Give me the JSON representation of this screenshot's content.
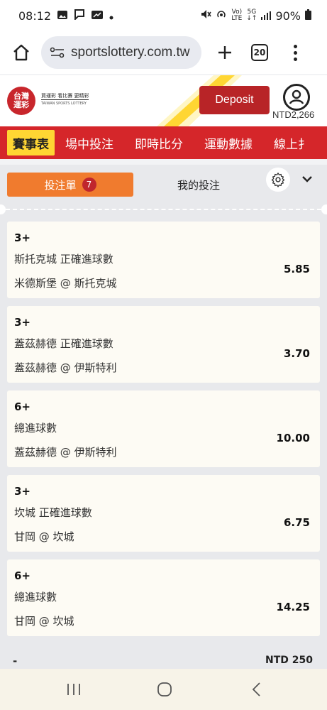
{
  "status_bar": {
    "time": "08:12",
    "battery": "90%",
    "lte_label": "LTE",
    "fiveg_label": "5G"
  },
  "browser": {
    "url": "sportslottery.com.tw",
    "tab_count": "20"
  },
  "header": {
    "logo_text": "台灣\n運彩",
    "logo_caption_top": "買運彩 看比賽 更精彩",
    "logo_caption_bottom": "TAIWAN SPORTS LOTTERY",
    "deposit_label": "Deposit",
    "balance": "NTD2,266"
  },
  "nav": {
    "items": [
      {
        "label": "賽事表",
        "active": true
      },
      {
        "label": "場中投注",
        "active": false
      },
      {
        "label": "即時比分",
        "active": false
      },
      {
        "label": "運動數據",
        "active": false
      },
      {
        "label": "線上扌",
        "active": false
      }
    ]
  },
  "slip": {
    "tab_active": "投注單",
    "badge_count": "7",
    "tab_other": "我的投注",
    "bets": [
      {
        "selection": "3+",
        "market": "斯托克城 正確進球數",
        "match": "米德斯堡 @ 斯托克城",
        "odds": "5.85"
      },
      {
        "selection": "3+",
        "market": "蓋茲赫德 正確進球數",
        "match": "蓋茲赫德 @ 伊斯特利",
        "odds": "3.70"
      },
      {
        "selection": "6+",
        "market": "總進球數",
        "match": "蓋茲赫德 @ 伊斯特利",
        "odds": "10.00"
      },
      {
        "selection": "3+",
        "market": "坎城 正確進球數",
        "match": "甘岡 @ 坎城",
        "odds": "6.75"
      },
      {
        "selection": "6+",
        "market": "總進球數",
        "match": "甘岡 @ 坎城",
        "odds": "14.25"
      }
    ],
    "summary_left": "-",
    "summary_right": "NTD 250"
  },
  "colors": {
    "brand_red": "#d5262a",
    "active_tab": "#f07b2e",
    "nav_active": "#ffd633",
    "deposit": "#b82427"
  }
}
